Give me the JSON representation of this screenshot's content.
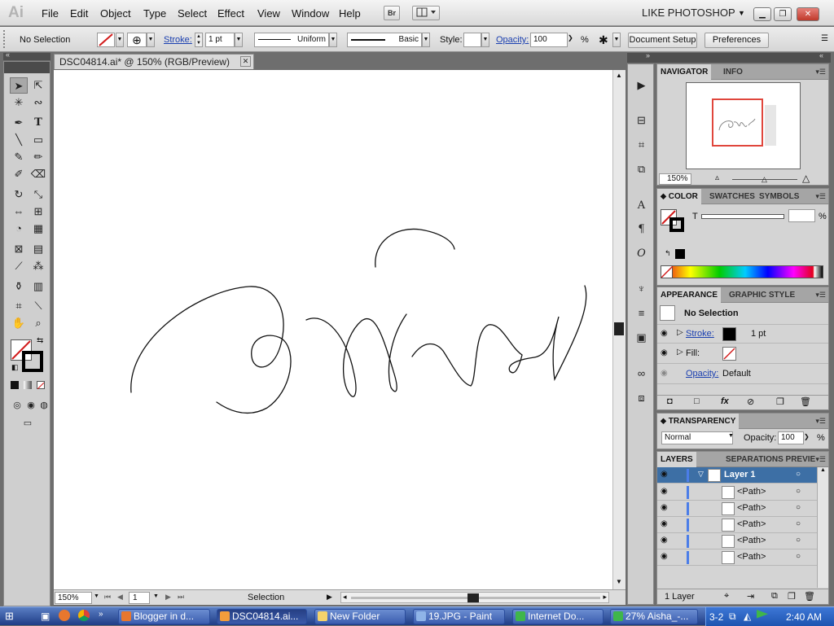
{
  "app": {
    "logo": "Ai",
    "menus": [
      "File",
      "Edit",
      "Object",
      "Type",
      "Select",
      "Effect",
      "View",
      "Window",
      "Help"
    ],
    "bridge_label": "Br",
    "workspace": "LIKE PHOTOSHOP",
    "window_buttons": [
      "minimize",
      "restore",
      "close"
    ]
  },
  "control_bar": {
    "selection": "No Selection",
    "stroke_label": "Stroke:",
    "stroke_value": "1 pt",
    "uniform_label": "Uniform",
    "basic_label": "Basic",
    "style_label": "Style:",
    "opacity_label": "Opacity:",
    "opacity_value": "100",
    "opacity_unit": "%",
    "document_setup": "Document Setup",
    "preferences": "Preferences"
  },
  "document": {
    "tab_title": "DSC04814.ai* @ 150% (RGB/Preview)",
    "zoom": "150%",
    "artboard": "1",
    "status": "Selection"
  },
  "navigator": {
    "tabs": [
      "NAVIGATOR",
      "INFO"
    ],
    "zoom": "150%"
  },
  "color": {
    "tabs": [
      "COLOR",
      "SWATCHES",
      "SYMBOLS"
    ],
    "tint_label": "T",
    "percent": "%"
  },
  "appearance": {
    "tabs": [
      "APPEARANCE",
      "GRAPHIC STYLE"
    ],
    "title": "No Selection",
    "stroke_label": "Stroke:",
    "stroke_value": "1 pt",
    "fill_label": "Fill:",
    "opacity_label": "Opacity:",
    "opacity_value": "Default"
  },
  "transparency": {
    "tab": "TRANSPARENCY",
    "blend_mode": "Normal",
    "opacity_label": "Opacity:",
    "opacity_value": "100",
    "percent": "%"
  },
  "layers": {
    "tabs": [
      "LAYERS",
      "SEPARATIONS PREVIE"
    ],
    "layer_name": "Layer 1",
    "items": [
      "<Path>",
      "<Path>",
      "<Path>",
      "<Path>",
      "<Path>"
    ],
    "count": "1 Layer"
  },
  "taskbar": {
    "items": [
      {
        "label": "Blogger in d...",
        "color": "#e8772e"
      },
      {
        "label": "DSC04814.ai...",
        "color": "#f29d3c"
      },
      {
        "label": "New Folder",
        "color": "#f4d36b"
      },
      {
        "label": "19.JPG - Paint",
        "color": "#8fb4e8"
      },
      {
        "label": "Internet Do...",
        "color": "#3fb64a"
      },
      {
        "label": "27% Aisha_-...",
        "color": "#3fb64a"
      }
    ],
    "pager": "3-2",
    "time": "2:40 AM"
  },
  "colors": {
    "accent_link": "#1a3fb0",
    "layer_highlight": "#3d6fa5",
    "taskbar": "#245edb"
  }
}
